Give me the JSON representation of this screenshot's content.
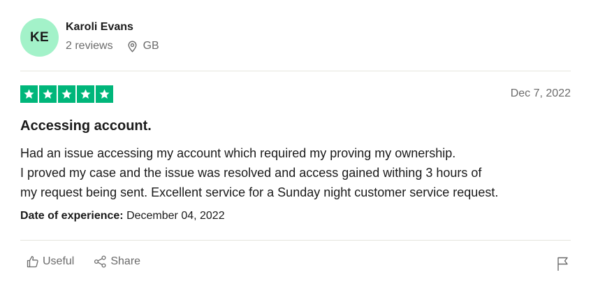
{
  "reviewer": {
    "initials": "KE",
    "name": "Karoli Evans",
    "review_count": "2 reviews",
    "country": "GB",
    "avatar_color": "#a3f2c9"
  },
  "rating": {
    "stars": 5,
    "max_stars": 5,
    "star_color": "#00b67a",
    "date": "Dec 7, 2022"
  },
  "review": {
    "title": "Accessing account.",
    "body_lines": [
      "Had an issue accessing my account which required my proving my ownership.",
      "I proved my case and the issue was resolved and access gained withing 3 hours of",
      "my request being sent. Excellent service for a Sunday night customer service request."
    ],
    "experience_label": "Date of experience:",
    "experience_date": "December 04, 2022"
  },
  "actions": {
    "useful_label": "Useful",
    "share_label": "Share",
    "useful_icon": "thumbs-up-icon",
    "share_icon": "share-icon",
    "report_icon": "flag-icon"
  }
}
